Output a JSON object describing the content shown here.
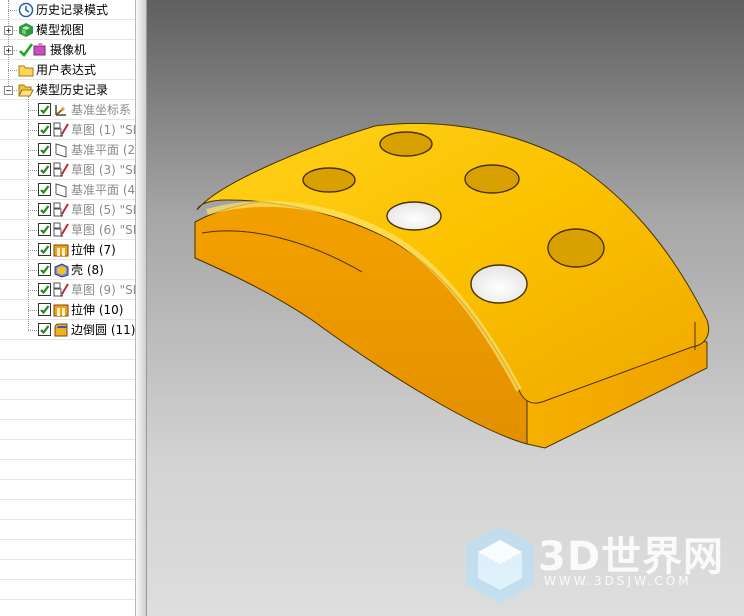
{
  "navigator": {
    "nodes": [
      {
        "label": "历史记录模式",
        "icon": "history-mode-icon",
        "indent": 0,
        "expander": "",
        "checkbox": false,
        "muted": false
      },
      {
        "label": "模型视图",
        "icon": "model-views-icon",
        "indent": 0,
        "expander": "+",
        "checkbox": false,
        "muted": false
      },
      {
        "label": "摄像机",
        "icon": "camera-icon",
        "indent": 0,
        "expander": "+",
        "checkbox": false,
        "check_mark": true,
        "muted": false
      },
      {
        "label": "用户表达式",
        "icon": "folder-icon",
        "indent": 0,
        "expander": "",
        "checkbox": false,
        "muted": false
      },
      {
        "label": "模型历史记录",
        "icon": "folder-open-icon",
        "indent": 0,
        "expander": "−",
        "checkbox": false,
        "muted": false
      },
      {
        "label": "基准坐标系",
        "icon": "datum-csys-icon",
        "indent": 1,
        "expander": "",
        "checkbox": true,
        "muted": true
      },
      {
        "label": "草图 (1) \"SK",
        "icon": "sketch-icon",
        "indent": 1,
        "expander": "",
        "checkbox": true,
        "muted": true
      },
      {
        "label": "基准平面 (2",
        "icon": "datum-plane-icon",
        "indent": 1,
        "expander": "",
        "checkbox": true,
        "muted": true
      },
      {
        "label": "草图 (3) \"SK",
        "icon": "sketch-icon",
        "indent": 1,
        "expander": "",
        "checkbox": true,
        "muted": true
      },
      {
        "label": "基准平面 (4",
        "icon": "datum-plane-icon",
        "indent": 1,
        "expander": "",
        "checkbox": true,
        "muted": true
      },
      {
        "label": "草图 (5) \"SK",
        "icon": "sketch-icon",
        "indent": 1,
        "expander": "",
        "checkbox": true,
        "muted": true
      },
      {
        "label": "草图 (6) \"SK",
        "icon": "sketch-icon",
        "indent": 1,
        "expander": "",
        "checkbox": true,
        "muted": true
      },
      {
        "label": "拉伸 (7)",
        "icon": "extrude-icon",
        "indent": 1,
        "expander": "",
        "checkbox": true,
        "muted": false
      },
      {
        "label": "壳 (8)",
        "icon": "shell-icon",
        "indent": 1,
        "expander": "",
        "checkbox": true,
        "muted": false
      },
      {
        "label": "草图 (9) \"SK",
        "icon": "sketch-icon",
        "indent": 1,
        "expander": "",
        "checkbox": true,
        "muted": true
      },
      {
        "label": "拉伸 (10)",
        "icon": "extrude-icon",
        "indent": 1,
        "expander": "",
        "checkbox": true,
        "muted": false
      },
      {
        "label": "边倒圆 (11)",
        "icon": "edge-blend-icon",
        "indent": 1,
        "expander": "",
        "checkbox": true,
        "muted": false
      }
    ],
    "empty_row_count": 14
  },
  "viewport": {
    "background_top": "#5f5f5f",
    "background_bottom": "#dedede",
    "model_color": "#f7b400",
    "model_edge_color": "#3a2a00"
  },
  "watermark": {
    "title": "3D世界网",
    "url": "WWW.3DSJW.COM",
    "logo_icon": "cube-logo-icon"
  }
}
